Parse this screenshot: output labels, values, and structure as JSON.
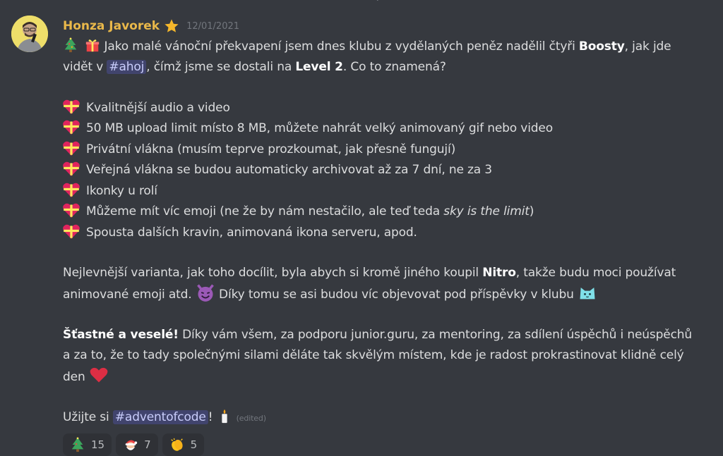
{
  "date_divider": "December 1, 2021",
  "message": {
    "author": "Honza Javorek",
    "timestamp": "12/01/2021",
    "line1_a": " Jako malé vánoční překvapení jsem dnes klubu z vydělaných peněz nadělil čtyři ",
    "line1_bold": "Boosty",
    "line1_b": ", jak jde",
    "line2_a": "vidět v ",
    "mention_ahoj": "#ahoj",
    "line2_b": ", čímž jsme se dostali na ",
    "line2_bold": "Level 2",
    "line2_c": ". Co to znamená?",
    "perks": [
      "Kvalitnější audio a video",
      "50 MB upload limit místo 8 MB, můžete nahrát velký animovaný gif nebo video",
      "Privátní vlákna (musím teprve prozkoumat, jak přesně fungují)",
      "Veřejná vlákna se budou automaticky archivovat až za 7 dní, ne za 3",
      "Ikonky u rolí",
      "Můžeme mít víc emoji (ne že by nám nestačilo, ale teď teda ",
      "Spousta dalších kravin, animovaná ikona serveru, apod."
    ],
    "perk6_italic": "sky is the limit",
    "perk6_end": ")",
    "para2_l1_a": "Nejlevnější varianta, jak toho docílit, byla abych si kromě jiného koupil ",
    "para2_l1_bold": "Nitro",
    "para2_l1_b": ", takže budu moci používat",
    "para2_l2_a": "animované emoji atd. ",
    "para2_l2_b": " Díky tomu se asi budou víc objevovat pod příspěvky v klubu ",
    "para3_bold": "Šťastné a veselé!",
    "para3_l1": " Díky vám všem, za podporu junior.guru, za mentoring, za sdílení úspěchů i neúspěchů",
    "para3_l2": "a za to, že to tady společnými silami děláte tak skvělým místem, kde je radost prokrastinovat klidně celý",
    "para3_l3": "den ",
    "final_a": "Užijte si ",
    "mention_advent": "#adventofcode",
    "final_b": "! ",
    "edited": "(edited)"
  },
  "reactions": [
    {
      "icon": "christmas-tree-icon",
      "count": "15"
    },
    {
      "icon": "santa-icon",
      "count": "7"
    },
    {
      "icon": "clapping-hands-icon",
      "count": "5"
    }
  ],
  "colors": {
    "background": "#36393f",
    "author": "#e9b84a",
    "mention_bg": "#41446d",
    "mention_text": "#c9cdfb",
    "text": "#dcddde",
    "muted": "#72767d"
  }
}
